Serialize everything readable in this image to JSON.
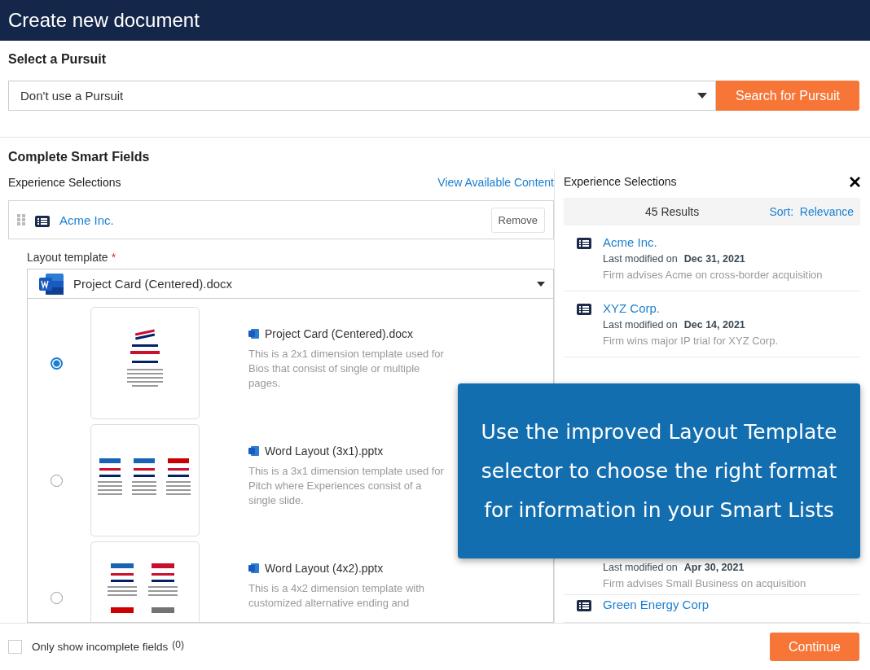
{
  "window": {
    "title": "Create new document"
  },
  "pursuit": {
    "heading": "Select a Pursuit",
    "value": "Don't use a Pursuit",
    "button": "Search for Pursuit"
  },
  "smart_fields": {
    "heading": "Complete Smart Fields",
    "left": {
      "label": "Experience Selections",
      "link": "View Available Content",
      "selection": {
        "title": "Acme Inc.",
        "remove": "Remove"
      },
      "layout_label": "Layout template",
      "required_mark": "*",
      "layout_value": "Project Card (Centered).docx",
      "options": [
        {
          "name": "Project Card (Centered).docx",
          "description": "This is a 2x1 dimension template used for Bios that consist of single or multiple pages.",
          "selected": true,
          "kind": "single"
        },
        {
          "name": "Word Layout (3x1).pptx",
          "description": "This is a 3x1 dimension template used for Pitch where Experiences consist of a single slide.",
          "selected": false,
          "kind": "triple"
        },
        {
          "name": "Word Layout (4x2).pptx",
          "description": "This is a 4x2 dimension template with customized alternative ending and",
          "selected": false,
          "kind": "grid"
        }
      ]
    },
    "right": {
      "label": "Experience Selections",
      "count": "45 Results",
      "sort_label": "Sort:",
      "sort_value": "Relevance",
      "items": [
        {
          "title": "Acme Inc.",
          "modified_label": "Last modified on",
          "date": "Dec 31, 2021",
          "description": "Firm advises Acme on cross-border acquisition"
        },
        {
          "title": "XYZ Corp.",
          "modified_label": "Last modified on",
          "date": "Dec 14, 2021",
          "description": "Firm wins major IP trial for XYZ Corp."
        },
        {
          "modified_label": "Last modified on",
          "date": "Apr 30, 2021",
          "description": "Firm advises Small Business on acquisition"
        },
        {
          "title": "Green Energy Corp"
        }
      ]
    }
  },
  "callout": {
    "text": "Use the improved Layout Template selector to choose the right format for information in your Smart Lists"
  },
  "footer": {
    "checkbox_label": "Only show incomplete fields",
    "count": "(0)",
    "checked": false,
    "button": "Continue"
  }
}
